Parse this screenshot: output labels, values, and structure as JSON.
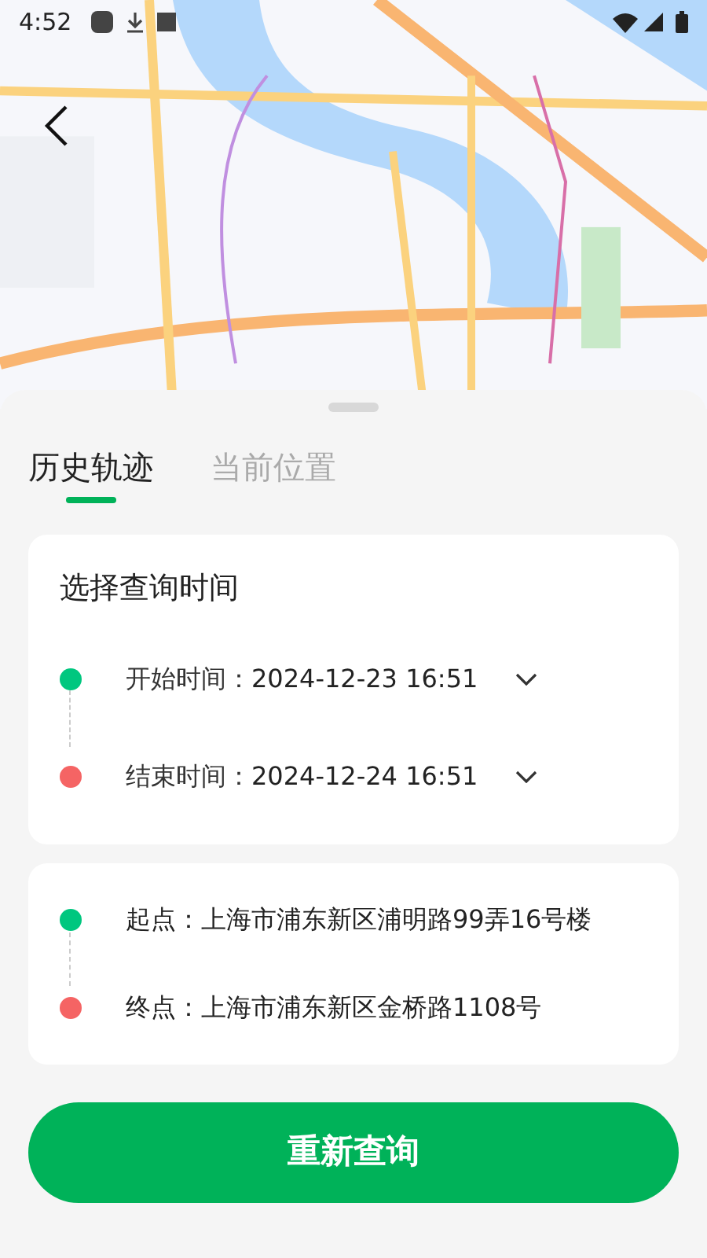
{
  "status_bar": {
    "time": "4:52"
  },
  "tabs": [
    {
      "label": "历史轨迹",
      "selected": true
    },
    {
      "label": "当前位置",
      "selected": false
    }
  ],
  "time_card": {
    "title": "选择查询时间",
    "rows": [
      {
        "label": "开始时间：",
        "value": "2024-12-23 16:51",
        "color": "#00c77f"
      },
      {
        "label": "结束时间：",
        "value": "2024-12-24 16:51",
        "color": "#f56464"
      }
    ]
  },
  "address_card": {
    "rows": [
      {
        "label": "起点：",
        "value": "上海市浦东新区浦明路99弄16号楼",
        "color": "#00c77f"
      },
      {
        "label": "终点：",
        "value": "上海市浦东新区金桥路1108号",
        "color": "#f56464"
      }
    ]
  },
  "button": "重新查询"
}
